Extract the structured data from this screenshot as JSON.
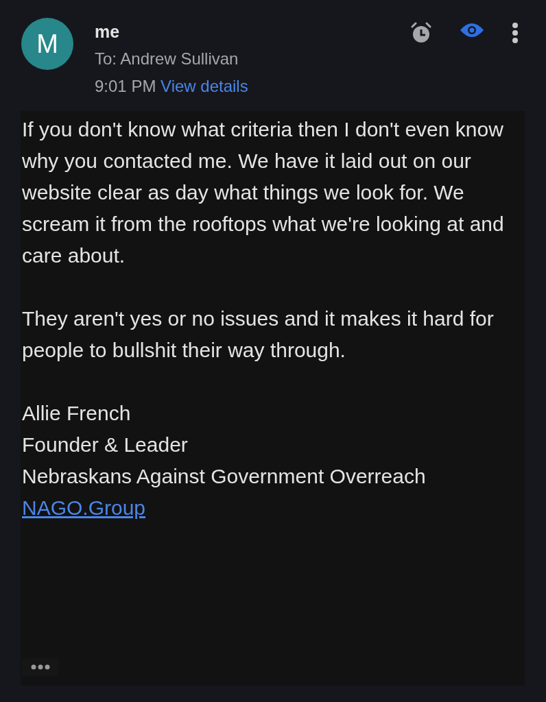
{
  "sender": {
    "avatar_letter": "M",
    "name": "me",
    "to": "To: Andrew Sullivan",
    "time": "9:01 PM",
    "details_link": "View details"
  },
  "body": {
    "paragraphs": [
      "If you don't know what criteria then I don't even know why you contacted me. We have it laid out on our website clear as day what things we look for. We scream it from the rooftops what we're looking at and care about.",
      "They aren't yes or no issues and it makes it hard for people to bullshit their way through."
    ],
    "signature": [
      "Allie French",
      "Founder & Leader",
      "Nebraskans Against Government Overreach"
    ],
    "link": "NAGO.Group"
  }
}
